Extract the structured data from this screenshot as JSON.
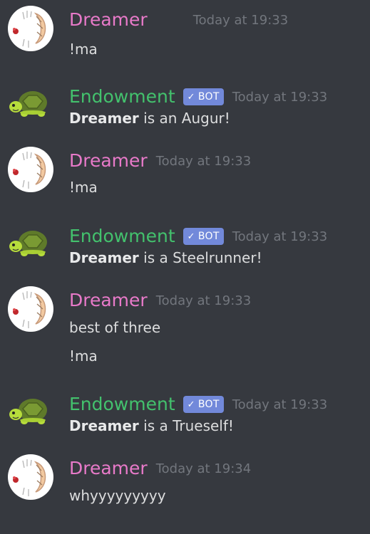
{
  "colors": {
    "background": "#36393f",
    "dreamer_name": "#e87ac9",
    "bot_name": "#43c16d",
    "bot_tag": "#7289da",
    "timestamp": "#72767d",
    "text": "#dcddde"
  },
  "messages": [
    {
      "author": "Dreamer",
      "avatar": "dreamer-avatar",
      "timestamp": "Today at 19:33",
      "lines": [
        "!ma"
      ]
    },
    {
      "author": "Endowment",
      "avatar": "turtle-avatar",
      "bot_label": "BOT",
      "timestamp": "Today at 19:33",
      "bold_name": "Dreamer",
      "text": "is an Augur!"
    },
    {
      "author": "Dreamer",
      "avatar": "dreamer-avatar",
      "timestamp": "Today at 19:33",
      "lines": [
        "!ma"
      ]
    },
    {
      "author": "Endowment",
      "avatar": "turtle-avatar",
      "bot_label": "BOT",
      "timestamp": "Today at 19:33",
      "bold_name": "Dreamer",
      "text": "is a Steelrunner!"
    },
    {
      "author": "Dreamer",
      "avatar": "dreamer-avatar",
      "timestamp": "Today at 19:33",
      "lines": [
        "best of three",
        "!ma"
      ]
    },
    {
      "author": "Endowment",
      "avatar": "turtle-avatar",
      "bot_label": "BOT",
      "timestamp": "Today at 19:33",
      "bold_name": "Dreamer",
      "text": "is a Trueself!"
    },
    {
      "author": "Dreamer",
      "avatar": "dreamer-avatar",
      "timestamp": "Today at 19:34",
      "lines": [
        "whyyyyyyyyy"
      ]
    }
  ]
}
